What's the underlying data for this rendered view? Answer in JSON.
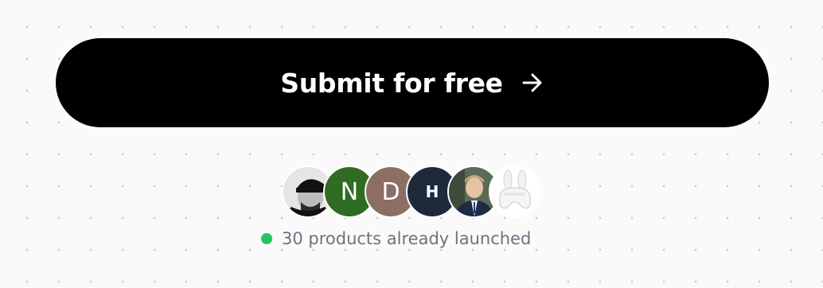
{
  "submit": {
    "label": "Submit for free",
    "icon": "arrow-right-icon"
  },
  "avatars": [
    {
      "kind": "photo",
      "desc": "man-with-cap",
      "bg": "#2b2b2b"
    },
    {
      "kind": "initial",
      "initial": "N",
      "bg": "#2f6b22"
    },
    {
      "kind": "initial",
      "initial": "D",
      "bg": "#8b6f63"
    },
    {
      "kind": "initial",
      "initial": "H",
      "bg": "#1e293b"
    },
    {
      "kind": "photo",
      "desc": "man-in-suit",
      "bg": "#4b5563"
    },
    {
      "kind": "photo",
      "desc": "bunny-logo",
      "bg": "#ffffff"
    }
  ],
  "status": {
    "text": "30 products already launched",
    "dot_color": "#22c55e"
  },
  "colors": {
    "button_bg": "#000000",
    "button_text": "#ffffff",
    "muted_text": "#6b7280"
  }
}
